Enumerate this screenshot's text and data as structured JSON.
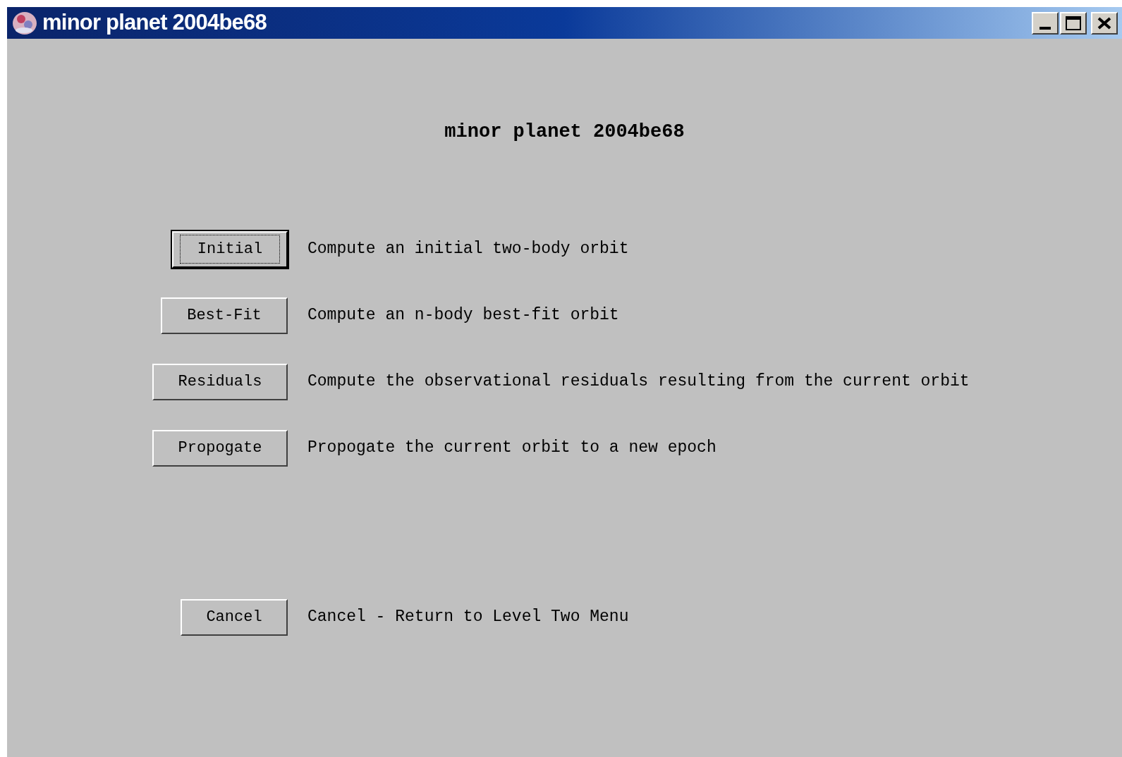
{
  "window": {
    "title": "minor planet 2004be68"
  },
  "heading": "minor planet 2004be68",
  "actions": [
    {
      "label": "Initial",
      "description": "Compute an initial two-body orbit",
      "focused": true
    },
    {
      "label": "Best-Fit",
      "description": "Compute an n-body best-fit orbit",
      "focused": false
    },
    {
      "label": "Residuals",
      "description": "Compute the observational residuals resulting from the current orbit",
      "focused": false
    },
    {
      "label": "Propogate",
      "description": "Propogate the current orbit to a new epoch",
      "focused": false
    }
  ],
  "cancel": {
    "label": "Cancel",
    "description": "Cancel - Return to Level Two Menu",
    "focused": false
  }
}
